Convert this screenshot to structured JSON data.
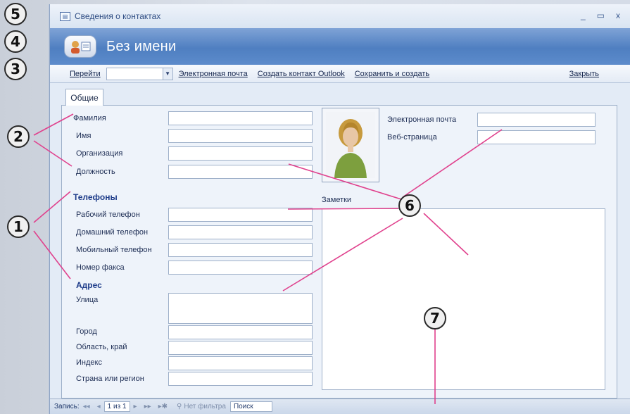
{
  "window": {
    "title": "Сведения о контактах",
    "minimize": "_",
    "maximize": "▭",
    "close": "x"
  },
  "header": {
    "title": "Без имени"
  },
  "toolbar": {
    "goto_label": "Перейти",
    "goto_value": "",
    "email_label": "Электронная почта",
    "outlook_label": "Создать контакт Outlook",
    "save_new_label": "Сохранить и создать",
    "close_label": "Закрыть"
  },
  "tabs": [
    {
      "label": "Общие"
    }
  ],
  "form": {
    "lastname": "Фамилия",
    "firstname": "Имя",
    "company": "Организация",
    "jobtitle": "Должность",
    "phones_heading": "Телефоны",
    "work_phone": "Рабочий телефон",
    "home_phone": "Домашний телефон",
    "mobile_phone": "Мобильный телефон",
    "fax": "Номер факса",
    "address_heading": "Адрес",
    "street": "Улица",
    "city": "Город",
    "region": "Область, край",
    "zip": "Индекс",
    "country": "Страна или регион",
    "email": "Электронная почта",
    "webpage": "Веб-страница",
    "notes": "Заметки"
  },
  "statusbar": {
    "record_label": "Запись:",
    "first": "◂◂",
    "prev": "◂",
    "record_value": "1 из 1",
    "next": "▸",
    "last": "▸▸",
    "new": "▸✱",
    "filter_label": "Нет фильтра",
    "search_label": "Поиск"
  },
  "callouts": [
    "5",
    "4",
    "3",
    "2",
    "1",
    "6",
    "7"
  ],
  "colors": {
    "header": "#4f7fc1",
    "panel": "#eef3fa",
    "accent_text": "#1f3d8a"
  }
}
